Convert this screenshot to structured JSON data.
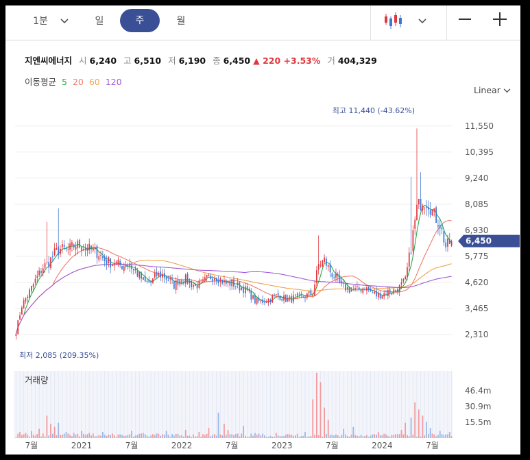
{
  "toolbar": {
    "interval_label": "1분",
    "day_label": "일",
    "week_label": "주",
    "month_label": "월",
    "chart_type_icon": "candlestick-icon",
    "zoom_out_icon": "minus-icon",
    "zoom_in_icon": "plus-icon"
  },
  "quote": {
    "name": "지엔씨에너지",
    "open_label": "시",
    "open": "6,240",
    "high_label": "고",
    "high": "6,510",
    "low_label": "저",
    "low": "6,190",
    "close_label": "종",
    "close": "6,450",
    "change": "▲ 220 +3.53%",
    "volume_label": "거",
    "volume": "404,329"
  },
  "colors": {
    "up": "#e0383e",
    "down": "#3a78d8",
    "ma5": "#2ca84a",
    "ma20": "#f07a6a",
    "ma60": "#f0a24a",
    "ma120": "#a05ad8",
    "accent": "#3a4f96"
  },
  "ma_legend": {
    "label": "이동평균",
    "periods": [
      "5",
      "20",
      "60",
      "120"
    ]
  },
  "scale_label": "Linear",
  "current_price_label": "6,450",
  "chart_data": {
    "type": "candlestick",
    "y_ticks": [
      "11,550",
      "10,395",
      "9,240",
      "8,085",
      "6,930",
      "5,775",
      "4,620",
      "3,465",
      "2,310"
    ],
    "y_tick_values": [
      11550,
      10395,
      9240,
      8085,
      6930,
      5775,
      4620,
      3465,
      2310
    ],
    "ylim": [
      1700,
      12150
    ],
    "x_ticks": [
      "7월",
      "2021",
      "7월",
      "2022",
      "7월",
      "2023",
      "7월",
      "2024",
      "7월"
    ],
    "x_tick_index": [
      8,
      34,
      60,
      86,
      112,
      138,
      164,
      190,
      216
    ],
    "n_weeks": 227,
    "max_annotation": "최고 11,440 (-43.62%)",
    "min_annotation": "최저 2,085 (209.35%)",
    "anchors": [
      [
        0,
        2450
      ],
      [
        3,
        3600
      ],
      [
        7,
        4200
      ],
      [
        10,
        4700
      ],
      [
        14,
        5300
      ],
      [
        17,
        5500
      ],
      [
        20,
        5900
      ],
      [
        23,
        6100
      ],
      [
        27,
        6050
      ],
      [
        31,
        6300
      ],
      [
        35,
        6200
      ],
      [
        39,
        6050
      ],
      [
        43,
        5900
      ],
      [
        46,
        5600
      ],
      [
        49,
        5500
      ],
      [
        52,
        5450
      ],
      [
        55,
        5350
      ],
      [
        58,
        5450
      ],
      [
        61,
        5200
      ],
      [
        64,
        4900
      ],
      [
        67,
        4600
      ],
      [
        70,
        4600
      ],
      [
        73,
        4950
      ],
      [
        76,
        4950
      ],
      [
        79,
        4750
      ],
      [
        82,
        4500
      ],
      [
        85,
        4750
      ],
      [
        88,
        4750
      ],
      [
        91,
        4550
      ],
      [
        94,
        4500
      ],
      [
        97,
        4600
      ],
      [
        100,
        4850
      ],
      [
        103,
        4900
      ],
      [
        106,
        4750
      ],
      [
        109,
        4550
      ],
      [
        112,
        4600
      ],
      [
        115,
        4450
      ],
      [
        118,
        4350
      ],
      [
        121,
        4150
      ],
      [
        124,
        3800
      ],
      [
        127,
        3750
      ],
      [
        130,
        3850
      ],
      [
        133,
        3950
      ],
      [
        136,
        4050
      ],
      [
        139,
        3900
      ],
      [
        142,
        3850
      ],
      [
        145,
        3950
      ],
      [
        148,
        3950
      ],
      [
        151,
        4050
      ],
      [
        154,
        4150
      ],
      [
        157,
        5400
      ],
      [
        160,
        5600
      ],
      [
        163,
        5100
      ],
      [
        166,
        4800
      ],
      [
        169,
        4450
      ],
      [
        172,
        4350
      ],
      [
        175,
        4250
      ],
      [
        178,
        4300
      ],
      [
        181,
        4400
      ],
      [
        184,
        4200
      ],
      [
        187,
        4050
      ],
      [
        190,
        4100
      ],
      [
        193,
        4200
      ],
      [
        196,
        4250
      ],
      [
        199,
        4400
      ],
      [
        202,
        4700
      ],
      [
        205,
        6200
      ],
      [
        208,
        7900
      ],
      [
        211,
        8300
      ],
      [
        214,
        8150
      ],
      [
        217,
        7600
      ],
      [
        220,
        7200
      ],
      [
        223,
        6200
      ],
      [
        226,
        6450
      ]
    ],
    "volume": {
      "y_ticks": [
        "46.4m",
        "30.9m",
        "15.5m"
      ],
      "y_tick_values": [
        46.4,
        30.9,
        15.5
      ],
      "ylim": [
        0,
        66
      ],
      "spikes": [
        [
          2,
          6
        ],
        [
          5,
          5
        ],
        [
          8,
          7
        ],
        [
          12,
          9
        ],
        [
          16,
          22
        ],
        [
          18,
          14
        ],
        [
          20,
          11
        ],
        [
          22,
          15
        ],
        [
          26,
          6
        ],
        [
          30,
          5
        ],
        [
          34,
          7
        ],
        [
          38,
          5
        ],
        [
          45,
          6
        ],
        [
          60,
          7
        ],
        [
          66,
          5
        ],
        [
          78,
          7
        ],
        [
          88,
          8
        ],
        [
          95,
          6
        ],
        [
          100,
          10
        ],
        [
          105,
          25
        ],
        [
          108,
          14
        ],
        [
          110,
          8
        ],
        [
          118,
          12
        ],
        [
          124,
          5
        ],
        [
          135,
          5
        ],
        [
          150,
          6
        ],
        [
          154,
          38
        ],
        [
          156,
          64
        ],
        [
          158,
          55
        ],
        [
          160,
          30
        ],
        [
          162,
          18
        ],
        [
          170,
          9
        ],
        [
          175,
          11
        ],
        [
          188,
          6
        ],
        [
          200,
          8
        ],
        [
          202,
          15
        ],
        [
          205,
          20
        ],
        [
          207,
          35
        ],
        [
          209,
          28
        ],
        [
          211,
          22
        ],
        [
          213,
          16
        ],
        [
          215,
          10
        ],
        [
          220,
          7
        ],
        [
          225,
          6
        ]
      ],
      "title": "거래량"
    }
  }
}
